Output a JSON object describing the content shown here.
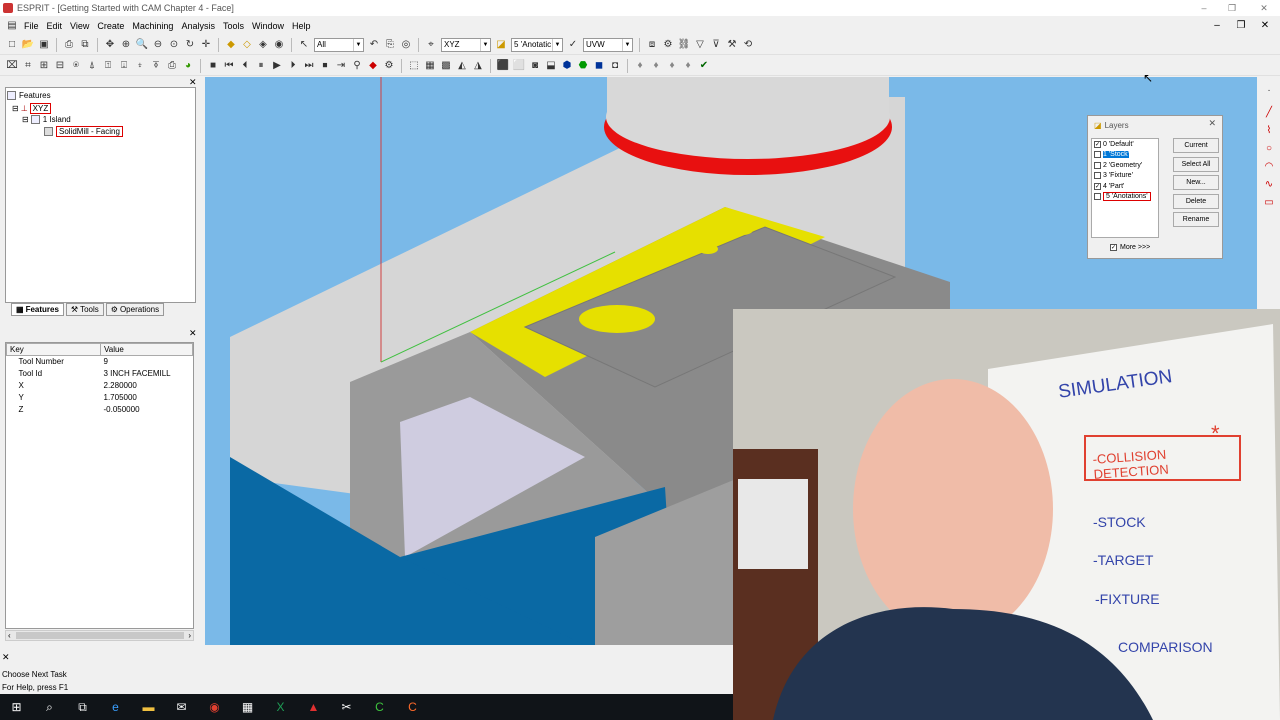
{
  "window": {
    "title": "ESPRIT - [Getting Started with CAM Chapter 4 - Face]",
    "min_glyph": "–",
    "restore_glyph": "❐",
    "close_glyph": "✕"
  },
  "menu": [
    "File",
    "Edit",
    "View",
    "Create",
    "Machining",
    "Analysis",
    "Tools",
    "Window",
    "Help"
  ],
  "toolbar1": {
    "filter_combo": "All",
    "plane_combo": "XYZ",
    "layer_combo": "5 'Anotatic",
    "work_combo": "UVW"
  },
  "tree": {
    "root": "Features",
    "xyz": "XYZ",
    "island": "1 Island",
    "operation": "SolidMill - Facing"
  },
  "tabs": [
    {
      "label": "Features",
      "active": true
    },
    {
      "label": "Tools",
      "active": false
    },
    {
      "label": "Operations",
      "active": false
    }
  ],
  "props": {
    "headers": [
      "Key",
      "Value"
    ],
    "rows": [
      {
        "key": "Tool Number",
        "value": "9"
      },
      {
        "key": "Tool Id",
        "value": "3 INCH FACEMILL"
      },
      {
        "key": "X",
        "value": "2.280000"
      },
      {
        "key": "Y",
        "value": "1.705000"
      },
      {
        "key": "Z",
        "value": "-0.050000"
      }
    ]
  },
  "layers": {
    "title": "Layers",
    "items": [
      {
        "label": "0 'Default'",
        "checked": true,
        "selected": false
      },
      {
        "label": "1 'Stock'",
        "checked": false,
        "selected": true
      },
      {
        "label": "2 'Geometry'",
        "checked": false,
        "selected": false
      },
      {
        "label": "3 'Fixture'",
        "checked": false,
        "selected": false
      },
      {
        "label": "4 'Part'",
        "checked": true,
        "selected": false
      },
      {
        "label": "5 'Anotations'",
        "checked": false,
        "selected": false
      }
    ],
    "buttons": [
      "Current",
      "Select All",
      "New...",
      "Delete",
      "Rename"
    ],
    "more": "More >>>"
  },
  "whiteboard": {
    "title": "SIMULATION",
    "items": [
      "-COLLISION DETECTION",
      "-STOCK",
      "-TARGET",
      "-FIXTURE",
      "COMPARISON"
    ],
    "star": "*"
  },
  "status": {
    "task": "Choose Next Task",
    "help": "For Help, press F1"
  },
  "colors": {
    "viewport_bg": "#7ab9e8",
    "tool_ring": "#e81010",
    "part_yellow": "#e6e000",
    "fixture_blue": "#0a69a4",
    "taskbar": "#101418"
  },
  "taskbar_icons": [
    "windows-start",
    "search",
    "task-view",
    "edge",
    "file-explorer",
    "mail",
    "chrome",
    "calculator",
    "excel",
    "acrobat",
    "snipping",
    "camtasia-green",
    "camtasia-orange"
  ]
}
